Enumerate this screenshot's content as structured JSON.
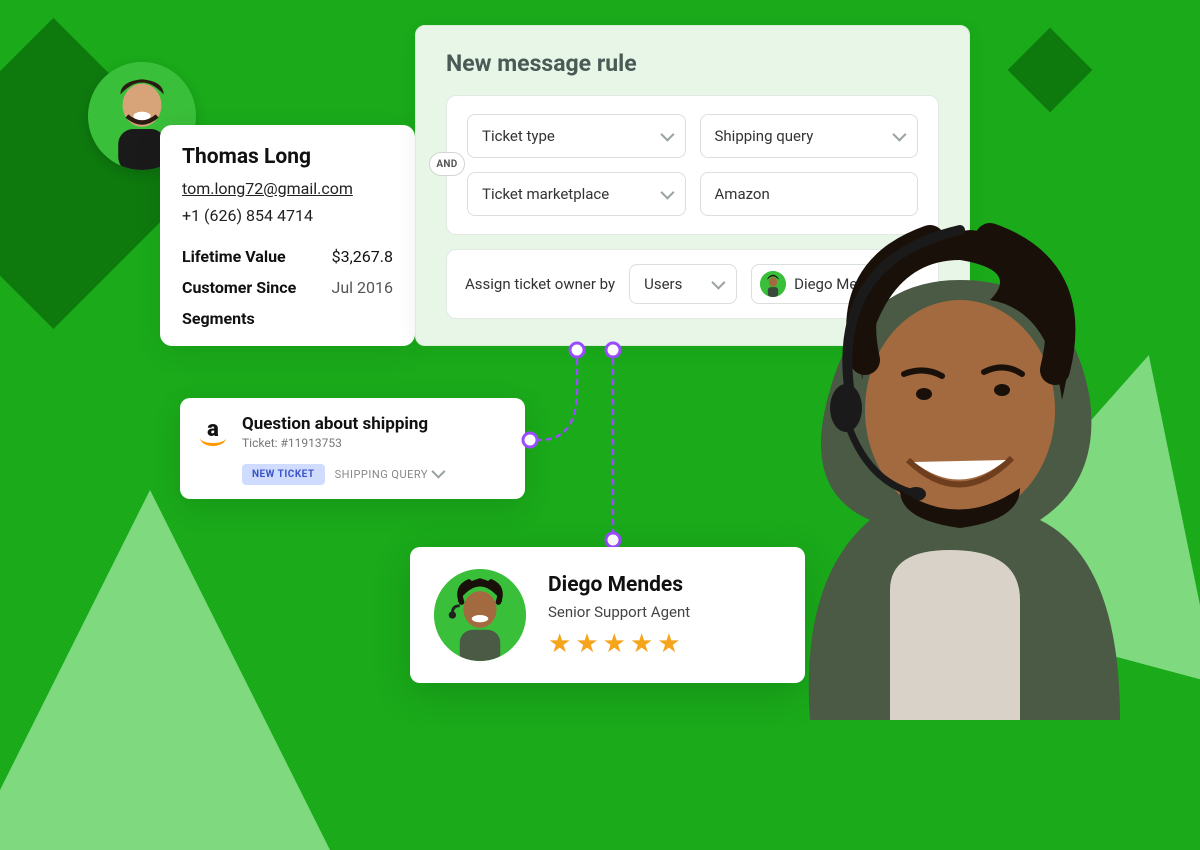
{
  "customer": {
    "name": "Thomas Long",
    "email": "tom.long72@gmail.com",
    "phone": "+1 (626) 854 4714",
    "lifetime_value_label": "Lifetime Value",
    "lifetime_value": "$3,267.8",
    "customer_since_label": "Customer Since",
    "customer_since": "Jul 2016",
    "segments_label": "Segments"
  },
  "ticket": {
    "title": "Question about shipping",
    "subtitle": "Ticket: #11913753",
    "new_tag": "NEW TICKET",
    "type_tag": "SHIPPING QUERY",
    "marketplace_icon": "a"
  },
  "rule": {
    "title": "New message rule",
    "and_label": "AND",
    "row1_field": "Ticket type",
    "row1_value": "Shipping query",
    "row2_field": "Ticket marketplace",
    "row2_value": "Amazon",
    "assign_label": "Assign ticket owner by",
    "assign_by_value": "Users",
    "assignee_name": "Diego Me"
  },
  "agent": {
    "name": "Diego Mendes",
    "role": "Senior Support Agent",
    "stars": 5
  }
}
